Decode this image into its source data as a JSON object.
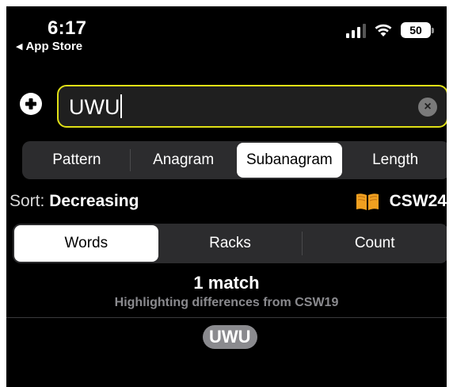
{
  "status_bar": {
    "time": "6:17",
    "back_app": "App Store",
    "battery": "50"
  },
  "search": {
    "value": "UWU",
    "accent_color": "#e0e016"
  },
  "mode_tabs": [
    {
      "label": "Pattern",
      "selected": false
    },
    {
      "label": "Anagram",
      "selected": false
    },
    {
      "label": "Subanagram",
      "selected": true
    },
    {
      "label": "Length",
      "selected": false
    }
  ],
  "sort": {
    "label": "Sort:",
    "value": "Decreasing"
  },
  "dictionary": {
    "name": "CSW24",
    "icon": "book-icon",
    "icon_color": "#f0a020"
  },
  "view_tabs": [
    {
      "label": "Words",
      "selected": true
    },
    {
      "label": "Racks",
      "selected": false
    },
    {
      "label": "Count",
      "selected": false
    }
  ],
  "results": {
    "summary": "1 match",
    "subtitle": "Highlighting differences from CSW19",
    "words": [
      "UWU"
    ]
  }
}
